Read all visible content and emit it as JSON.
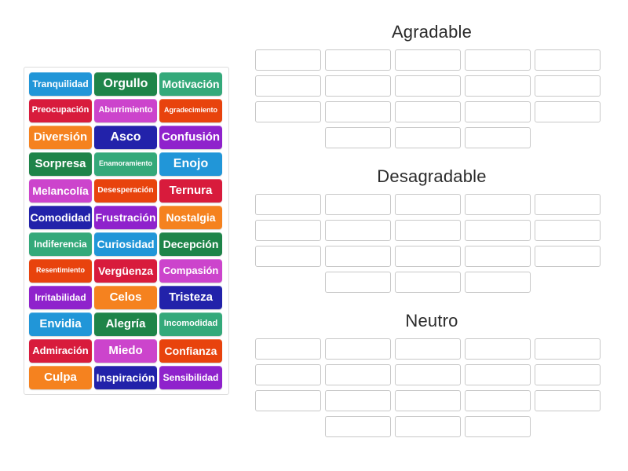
{
  "tray": {
    "name": "word-tile-tray",
    "tiles": [
      {
        "label": "Tranquilidad",
        "color": "#2196d8",
        "font_size": 12
      },
      {
        "label": "Orgullo",
        "color": "#1e8449",
        "font_size": 16
      },
      {
        "label": "Motivación",
        "color": "#34a97a",
        "font_size": 14
      },
      {
        "label": "Preocupación",
        "color": "#d81b3c",
        "font_size": 11
      },
      {
        "label": "Aburrimiento",
        "color": "#cc44cc",
        "font_size": 11
      },
      {
        "label": "Agradecimiento",
        "color": "#e8430d",
        "font_size": 9
      },
      {
        "label": "Diversión",
        "color": "#f5821f",
        "font_size": 15
      },
      {
        "label": "Asco",
        "color": "#2222aa",
        "font_size": 16
      },
      {
        "label": "Confusión",
        "color": "#8f22cc",
        "font_size": 15
      },
      {
        "label": "Sorpresa",
        "color": "#1e8449",
        "font_size": 15
      },
      {
        "label": "Enamoramiento",
        "color": "#34a97a",
        "font_size": 9
      },
      {
        "label": "Enojo",
        "color": "#2196d8",
        "font_size": 16
      },
      {
        "label": "Melancolía",
        "color": "#cc44cc",
        "font_size": 14
      },
      {
        "label": "Desesperación",
        "color": "#e8430d",
        "font_size": 10
      },
      {
        "label": "Ternura",
        "color": "#d81b3c",
        "font_size": 15
      },
      {
        "label": "Comodidad",
        "color": "#2222aa",
        "font_size": 14
      },
      {
        "label": "Frustración",
        "color": "#8f22cc",
        "font_size": 14
      },
      {
        "label": "Nostalgia",
        "color": "#f5821f",
        "font_size": 14
      },
      {
        "label": "Indiferencia",
        "color": "#34a97a",
        "font_size": 12
      },
      {
        "label": "Curiosidad",
        "color": "#2196d8",
        "font_size": 14
      },
      {
        "label": "Decepción",
        "color": "#1e8449",
        "font_size": 14
      },
      {
        "label": "Resentimiento",
        "color": "#e8430d",
        "font_size": 9
      },
      {
        "label": "Vergüenza",
        "color": "#d81b3c",
        "font_size": 14
      },
      {
        "label": "Compasión",
        "color": "#cc44cc",
        "font_size": 13
      },
      {
        "label": "Irritabilidad",
        "color": "#8f22cc",
        "font_size": 12
      },
      {
        "label": "Celos",
        "color": "#f5821f",
        "font_size": 15
      },
      {
        "label": "Tristeza",
        "color": "#2222aa",
        "font_size": 15
      },
      {
        "label": "Envidia",
        "color": "#2196d8",
        "font_size": 15
      },
      {
        "label": "Alegría",
        "color": "#1e8449",
        "font_size": 15
      },
      {
        "label": "Incomodidad",
        "color": "#34a97a",
        "font_size": 11
      },
      {
        "label": "Admiración",
        "color": "#d81b3c",
        "font_size": 13
      },
      {
        "label": "Miedo",
        "color": "#cc44cc",
        "font_size": 15
      },
      {
        "label": "Confianza",
        "color": "#e8430d",
        "font_size": 14
      },
      {
        "label": "Culpa",
        "color": "#f5821f",
        "font_size": 15
      },
      {
        "label": "Inspiración",
        "color": "#2222aa",
        "font_size": 14
      },
      {
        "label": "Sensibilidad",
        "color": "#8f22cc",
        "font_size": 12
      }
    ]
  },
  "categories": [
    {
      "title": "Agradable",
      "slot_rows": [
        5,
        5,
        5,
        3
      ],
      "slot_values": [
        "",
        "",
        "",
        "",
        "",
        "",
        "",
        "",
        "",
        "",
        "",
        "",
        "",
        "",
        "",
        "",
        "",
        ""
      ]
    },
    {
      "title": "Desagradable",
      "slot_rows": [
        5,
        5,
        5,
        3
      ],
      "slot_values": [
        "",
        "",
        "",
        "",
        "",
        "",
        "",
        "",
        "",
        "",
        "",
        "",
        "",
        "",
        "",
        "",
        "",
        ""
      ]
    },
    {
      "title": "Neutro",
      "slot_rows": [
        5,
        5,
        5,
        3
      ],
      "slot_values": [
        "",
        "",
        "",
        "",
        "",
        "",
        "",
        "",
        "",
        "",
        "",
        "",
        "",
        "",
        "",
        "",
        "",
        ""
      ]
    }
  ]
}
